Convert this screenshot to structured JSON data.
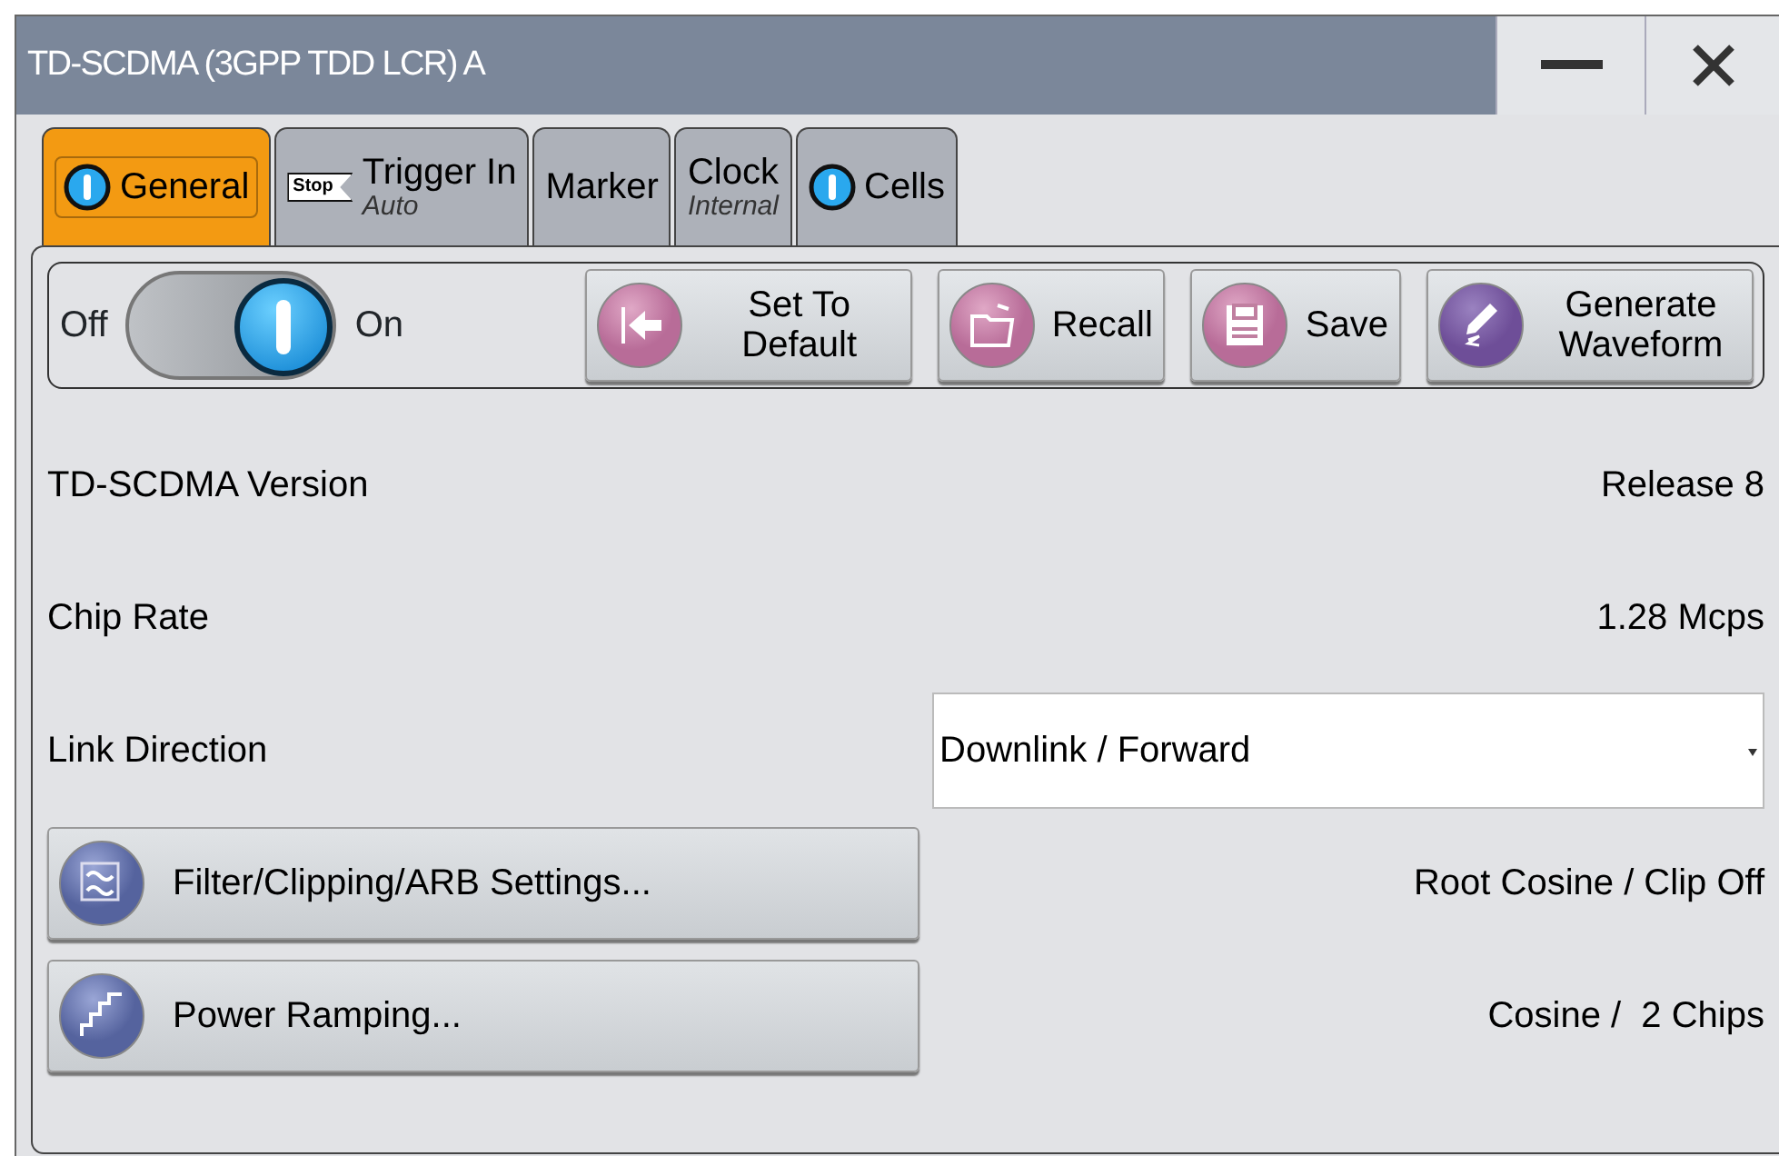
{
  "window": {
    "title": "TD-SCDMA (3GPP TDD LCR) A"
  },
  "tabs": [
    {
      "label": "General",
      "status_on": true,
      "selected": true
    },
    {
      "label": "Trigger In",
      "sublabel": "Auto",
      "badge": "Stop",
      "selected": false
    },
    {
      "label": "Marker",
      "selected": false
    },
    {
      "label": "Clock",
      "sublabel": "Internal",
      "selected": false
    },
    {
      "label": "Cells",
      "status_on": true,
      "selected": false
    }
  ],
  "state_switch": {
    "off_label": "Off",
    "on_label": "On",
    "on": true
  },
  "toolbar_buttons": [
    {
      "label": "Set To Default"
    },
    {
      "label": "Recall"
    },
    {
      "label": "Save"
    },
    {
      "label": "Generate Waveform"
    }
  ],
  "settings": [
    {
      "kind": "value",
      "label": "TD-SCDMA Version",
      "value": "Release 8"
    },
    {
      "kind": "value",
      "label": "Chip Rate",
      "value": "1.28 Mcps"
    },
    {
      "kind": "dropdown",
      "label": "Link Direction",
      "value": "Downlink / Forward"
    },
    {
      "kind": "button",
      "label": "Filter/Clipping/ARB Settings...",
      "value": "Root Cosine / Clip Off"
    },
    {
      "kind": "button",
      "label": "Power Ramping...",
      "value": "Cosine /  2 Chips"
    }
  ]
}
